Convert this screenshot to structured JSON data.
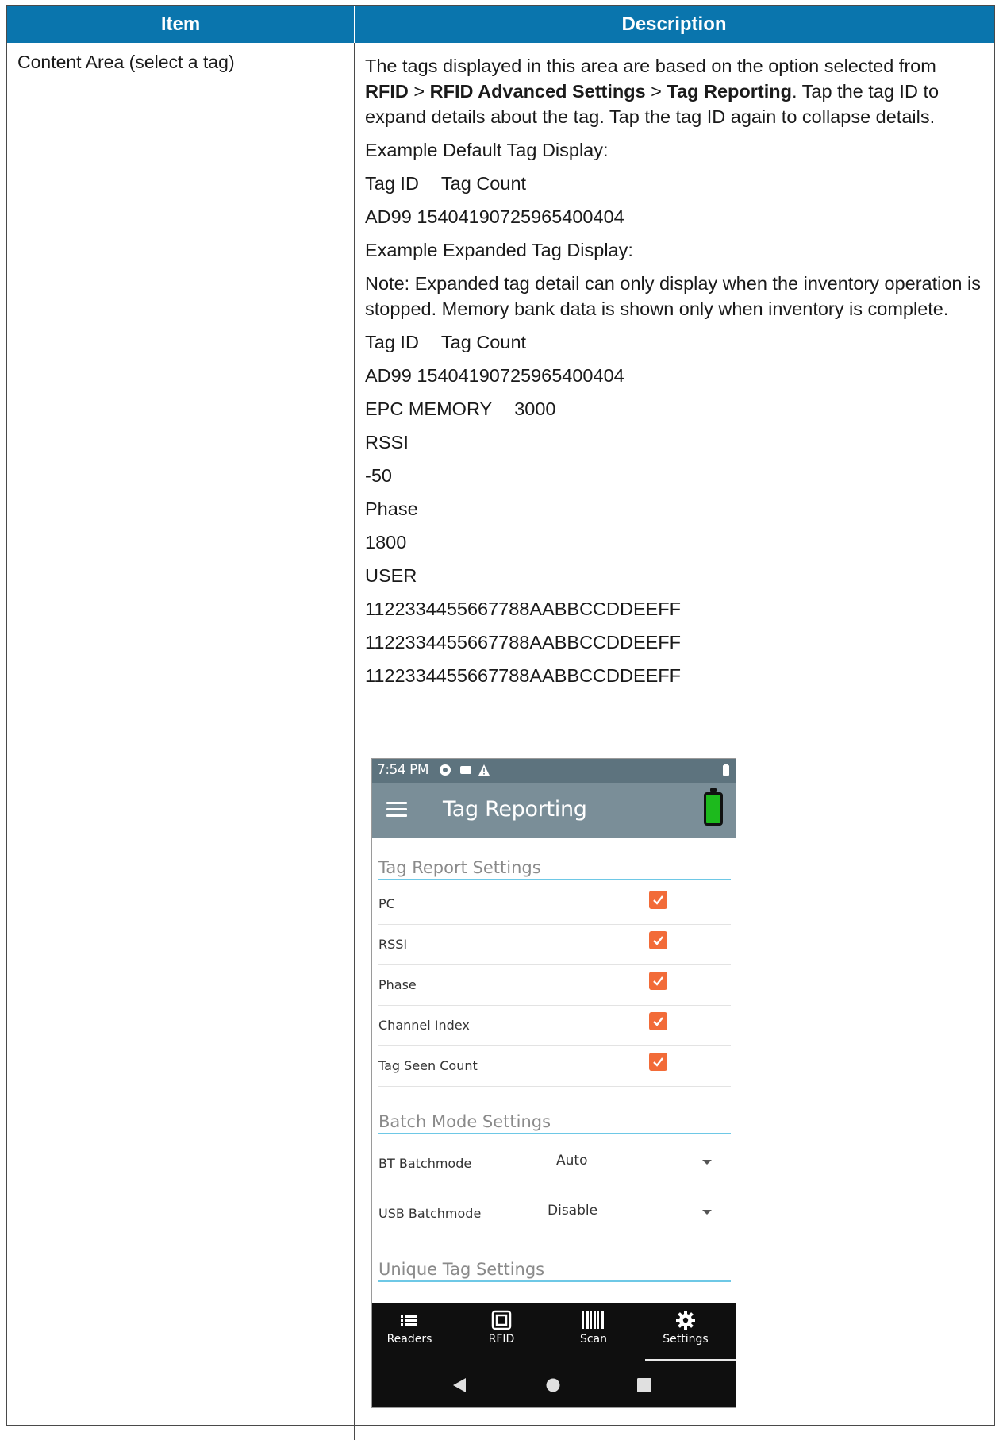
{
  "table": {
    "headers": {
      "item": "Item",
      "description": "Description"
    },
    "row": {
      "item": "Content Area (select a tag)",
      "intro": {
        "text1": "The tags displayed in this area are based on the option selected from ",
        "b1": "RFID",
        "sep1": " > ",
        "b2": "RFID Advanced Settings",
        "sep2": " > ",
        "b3": "Tag Reporting",
        "text2": ". Tap the tag ID to expand details about the tag. Tap the tag ID again to collapse details."
      },
      "example_default_label": "Example Default Tag Display:",
      "default_tag_id_label": "Tag ID",
      "default_tag_count_label": "Tag Count",
      "default_tag_line": "AD99 1540419072596540040​4",
      "example_expanded_label": "Example Expanded Tag Display:",
      "note": "Note: Expanded tag detail can only display when the inventory operation is stopped. Memory bank data is shown only when inventory is complete.",
      "expanded_tag_id_label": "Tag ID",
      "expanded_tag_count_label": "Tag Count",
      "expanded_tag_line": "AD99 1540419072596540040​4",
      "epc_label": "EPC MEMORY",
      "epc_value": "3000",
      "rssi_label": "RSSI",
      "rssi_value": "-50",
      "phase_label": "Phase",
      "phase_value": "1800",
      "user_label": "USER",
      "user_lines": [
        "1122334455667788AABBCCDDEEFF",
        "1122334455667788AABBCCDDEEFF",
        "1122334455667788AABBCCDDEEFF"
      ]
    }
  },
  "phone": {
    "status_time": "7:54 PM",
    "title": "Tag Reporting",
    "tag_report_section": "Tag Report Settings",
    "tag_report_items": [
      {
        "label": "PC",
        "checked": true
      },
      {
        "label": "RSSI",
        "checked": true
      },
      {
        "label": "Phase",
        "checked": true
      },
      {
        "label": "Channel Index",
        "checked": true
      },
      {
        "label": "Tag Seen Count",
        "checked": true
      }
    ],
    "batch_section": "Batch Mode Settings",
    "bt_batchmode_label": "BT Batchmode",
    "bt_batchmode_value": "Auto",
    "usb_batchmode_label": "USB Batchmode",
    "usb_batchmode_value": "Disable",
    "unique_section": "Unique Tag Settings",
    "nav": [
      "Readers",
      "RFID",
      "Scan",
      "Settings"
    ],
    "accent_color": "#f26b38",
    "appbar_color": "#7a8e98"
  }
}
